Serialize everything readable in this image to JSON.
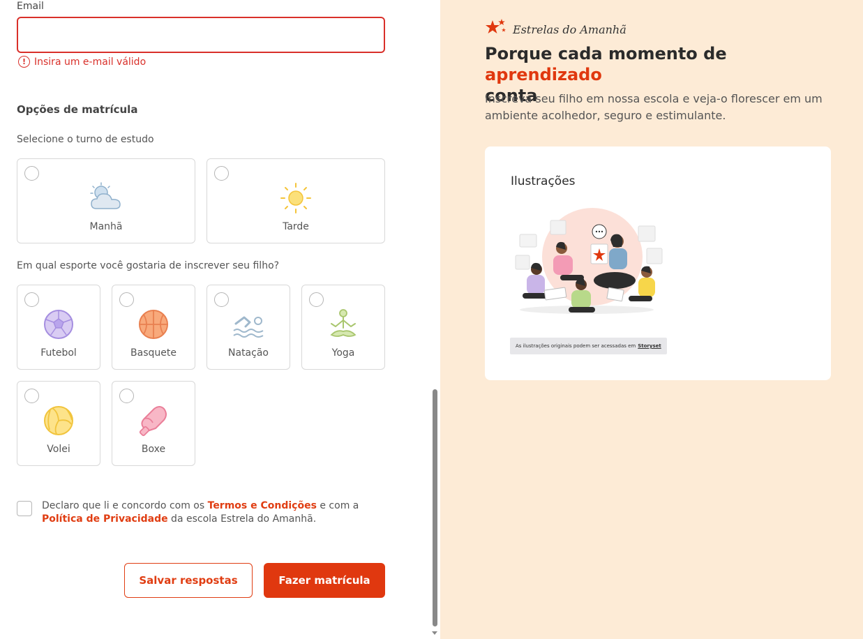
{
  "form": {
    "email": {
      "label": "Email",
      "value": "",
      "placeholder": "",
      "error": "Insira um e-mail válido"
    },
    "enrollment": {
      "title": "Opções de matrícula",
      "shift_question": "Selecione o turno de estudo",
      "shifts": [
        {
          "label": "Manhã",
          "icon": "cloud-sun-icon"
        },
        {
          "label": "Tarde",
          "icon": "sun-icon"
        }
      ],
      "sport_question": "Em qual esporte você gostaria de inscrever seu filho?",
      "sports": [
        {
          "label": "Futebol",
          "icon": "soccer-ball-icon"
        },
        {
          "label": "Basquete",
          "icon": "basketball-icon"
        },
        {
          "label": "Natação",
          "icon": "swimmer-icon"
        },
        {
          "label": "Yoga",
          "icon": "yoga-icon"
        },
        {
          "label": "Volei",
          "icon": "volleyball-icon"
        },
        {
          "label": "Boxe",
          "icon": "boxing-glove-icon"
        }
      ]
    },
    "terms": {
      "prefix": "Declaro que li e concordo com os ",
      "terms_link": "Termos e Condições",
      "middle": " e com a ",
      "privacy_link": "Política de Privacidade",
      "suffix": " da escola Estrela do Amanhã."
    },
    "buttons": {
      "save": "Salvar respostas",
      "submit": "Fazer matrícula"
    }
  },
  "aside": {
    "brand": "Estrelas do Amanhã",
    "title_part1": "Porque cada momento de ",
    "title_accent": "aprendizado",
    "title_part2": "conta",
    "subtitle": "Inscreva seu filho em nossa escola e veja-o florescer em um ambiente acolhedor, seguro e estimulante.",
    "illustration_card": {
      "title": "Ilustrações",
      "credit_text": "As ilustrações originais podem ser acessadas em",
      "credit_link": "Storyset"
    }
  },
  "colors": {
    "accent": "#e0380f",
    "error": "#d9302a",
    "aside_bg": "#fdebd6"
  }
}
